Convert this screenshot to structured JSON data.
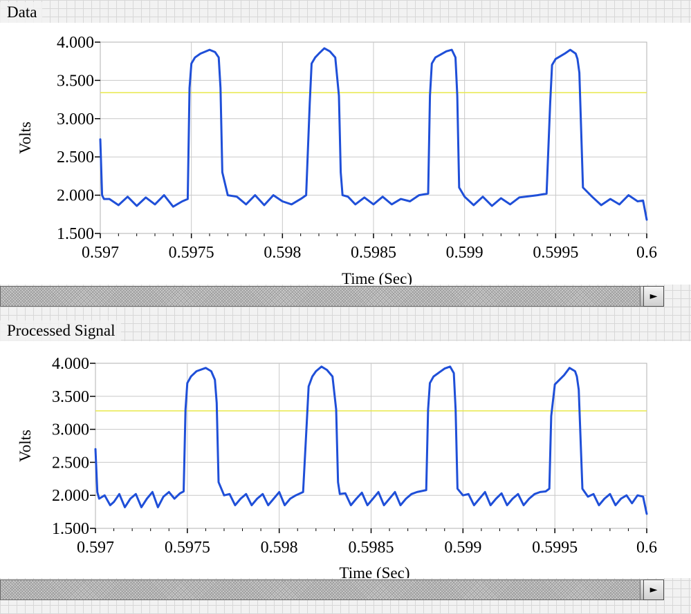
{
  "panels": [
    {
      "title": "Data",
      "scroll_arrow": "►",
      "chart_data": {
        "type": "line",
        "xlabel": "Time (Sec)",
        "ylabel": "Volts",
        "xlim": [
          0.597,
          0.6
        ],
        "ylim": [
          1.5,
          4.0
        ],
        "x_ticks": [
          "0.597",
          "0.5975",
          "0.598",
          "0.5985",
          "0.599",
          "0.5995",
          "0.6"
        ],
        "y_ticks": [
          "1.500",
          "2.000",
          "2.500",
          "3.000",
          "3.500",
          "4.000"
        ],
        "threshold": 3.34,
        "colors": {
          "signal": "#1f4fd8",
          "threshold": "#e8e84a"
        },
        "series": [
          {
            "x": [
              0.597,
              0.59701,
              0.59702,
              0.59705,
              0.5971,
              0.59715,
              0.5972,
              0.59725,
              0.5973,
              0.59735,
              0.5974,
              0.59745,
              0.59748,
              0.59749,
              0.5975,
              0.59752,
              0.59755,
              0.5976,
              0.59763,
              0.59765,
              0.59766,
              0.59767,
              0.5977,
              0.59775,
              0.5978,
              0.59785,
              0.5979,
              0.59795,
              0.598,
              0.59805,
              0.5981,
              0.59813,
              0.59815,
              0.59816,
              0.59818,
              0.5982,
              0.59823,
              0.59826,
              0.59829,
              0.59831,
              0.59832,
              0.59833,
              0.59836,
              0.5984,
              0.59845,
              0.5985,
              0.59855,
              0.5986,
              0.59865,
              0.5987,
              0.59875,
              0.5988,
              0.59881,
              0.59882,
              0.59884,
              0.5989,
              0.59893,
              0.59895,
              0.59896,
              0.59897,
              0.599,
              0.59905,
              0.5991,
              0.59915,
              0.5992,
              0.59925,
              0.5993,
              0.5994,
              0.59945,
              0.59947,
              0.59948,
              0.5995,
              0.59955,
              0.59958,
              0.59961,
              0.59962,
              0.59963,
              0.59965,
              0.5997,
              0.59975,
              0.5998,
              0.59985,
              0.5999,
              0.59995,
              0.59998,
              0.6
            ],
            "y": [
              2.73,
              2.0,
              1.95,
              1.95,
              1.87,
              1.98,
              1.86,
              1.97,
              1.88,
              2.0,
              1.85,
              1.92,
              1.95,
              3.4,
              3.72,
              3.8,
              3.85,
              3.9,
              3.87,
              3.8,
              3.4,
              2.3,
              2.0,
              1.98,
              1.88,
              2.0,
              1.87,
              2.0,
              1.92,
              1.88,
              1.95,
              2.0,
              3.2,
              3.72,
              3.8,
              3.85,
              3.92,
              3.88,
              3.8,
              3.3,
              2.3,
              2.0,
              1.98,
              1.88,
              1.97,
              1.88,
              1.98,
              1.88,
              1.95,
              1.92,
              2.0,
              2.02,
              3.3,
              3.72,
              3.8,
              3.88,
              3.9,
              3.8,
              3.3,
              2.1,
              1.98,
              1.87,
              1.98,
              1.86,
              1.96,
              1.88,
              1.97,
              2.0,
              2.02,
              3.2,
              3.7,
              3.78,
              3.85,
              3.9,
              3.85,
              3.78,
              3.6,
              2.1,
              1.98,
              1.87,
              1.95,
              1.88,
              2.0,
              1.92,
              1.93,
              1.68
            ]
          }
        ]
      }
    },
    {
      "title": "Processed Signal",
      "scroll_arrow": "►",
      "chart_data": {
        "type": "line",
        "xlabel": "Time (Sec)",
        "ylabel": "Volts",
        "xlim": [
          0.597,
          0.6
        ],
        "ylim": [
          1.5,
          4.0
        ],
        "x_ticks": [
          "0.597",
          "0.5975",
          "0.598",
          "0.5985",
          "0.599",
          "0.5995",
          "0.6"
        ],
        "y_ticks": [
          "1.500",
          "2.000",
          "2.500",
          "3.000",
          "3.500",
          "4.000"
        ],
        "threshold": 3.28,
        "colors": {
          "signal": "#1f4fd8",
          "threshold": "#e8e84a"
        },
        "series": [
          {
            "x": [
              0.597,
              0.59701,
              0.59702,
              0.59705,
              0.59708,
              0.5971,
              0.59713,
              0.59716,
              0.59719,
              0.59722,
              0.59725,
              0.59728,
              0.59731,
              0.59734,
              0.59737,
              0.5974,
              0.59743,
              0.59746,
              0.59748,
              0.59749,
              0.5975,
              0.59752,
              0.59755,
              0.5976,
              0.59763,
              0.59765,
              0.59766,
              0.59767,
              0.5977,
              0.59773,
              0.59776,
              0.59779,
              0.59782,
              0.59785,
              0.59788,
              0.59791,
              0.59794,
              0.59797,
              0.598,
              0.59803,
              0.59806,
              0.59809,
              0.59813,
              0.59815,
              0.59816,
              0.59818,
              0.5982,
              0.59823,
              0.59826,
              0.59829,
              0.59831,
              0.59832,
              0.59833,
              0.59836,
              0.59839,
              0.59842,
              0.59845,
              0.59848,
              0.59851,
              0.59854,
              0.59857,
              0.5986,
              0.59863,
              0.59866,
              0.59869,
              0.59872,
              0.59875,
              0.5988,
              0.59881,
              0.59882,
              0.59884,
              0.5989,
              0.59893,
              0.59895,
              0.59896,
              0.59897,
              0.599,
              0.59903,
              0.59906,
              0.59909,
              0.59912,
              0.59915,
              0.59918,
              0.59921,
              0.59924,
              0.59927,
              0.5993,
              0.59933,
              0.59936,
              0.59939,
              0.59942,
              0.59945,
              0.59947,
              0.59948,
              0.5995,
              0.59955,
              0.59958,
              0.59961,
              0.59962,
              0.59963,
              0.59965,
              0.59968,
              0.59971,
              0.59974,
              0.59977,
              0.5998,
              0.59983,
              0.59986,
              0.59989,
              0.59992,
              0.59995,
              0.59998,
              0.6
            ],
            "y": [
              2.7,
              2.05,
              1.95,
              2.0,
              1.85,
              1.9,
              2.02,
              1.82,
              1.95,
              2.02,
              1.82,
              1.95,
              2.05,
              1.82,
              1.98,
              2.05,
              1.95,
              2.03,
              2.06,
              3.3,
              3.7,
              3.8,
              3.88,
              3.93,
              3.88,
              3.75,
              3.4,
              2.2,
              2.0,
              2.02,
              1.85,
              1.95,
              2.02,
              1.85,
              1.95,
              2.02,
              1.85,
              1.95,
              2.05,
              1.85,
              1.95,
              2.0,
              2.05,
              3.1,
              3.65,
              3.8,
              3.88,
              3.95,
              3.9,
              3.8,
              3.3,
              2.2,
              2.02,
              2.03,
              1.85,
              1.95,
              2.04,
              1.85,
              1.95,
              2.05,
              1.85,
              1.95,
              2.05,
              1.85,
              1.95,
              2.02,
              2.05,
              2.08,
              3.3,
              3.7,
              3.8,
              3.92,
              3.95,
              3.85,
              3.3,
              2.1,
              2.0,
              2.02,
              1.85,
              1.95,
              2.05,
              1.85,
              1.95,
              2.03,
              1.85,
              1.95,
              2.02,
              1.85,
              1.95,
              2.02,
              2.05,
              2.06,
              2.1,
              3.2,
              3.68,
              3.82,
              3.93,
              3.88,
              3.8,
              3.6,
              2.1,
              1.98,
              2.02,
              1.85,
              1.95,
              2.02,
              1.85,
              1.95,
              2.0,
              1.88,
              2.0,
              1.98,
              1.72
            ]
          }
        ]
      }
    }
  ]
}
